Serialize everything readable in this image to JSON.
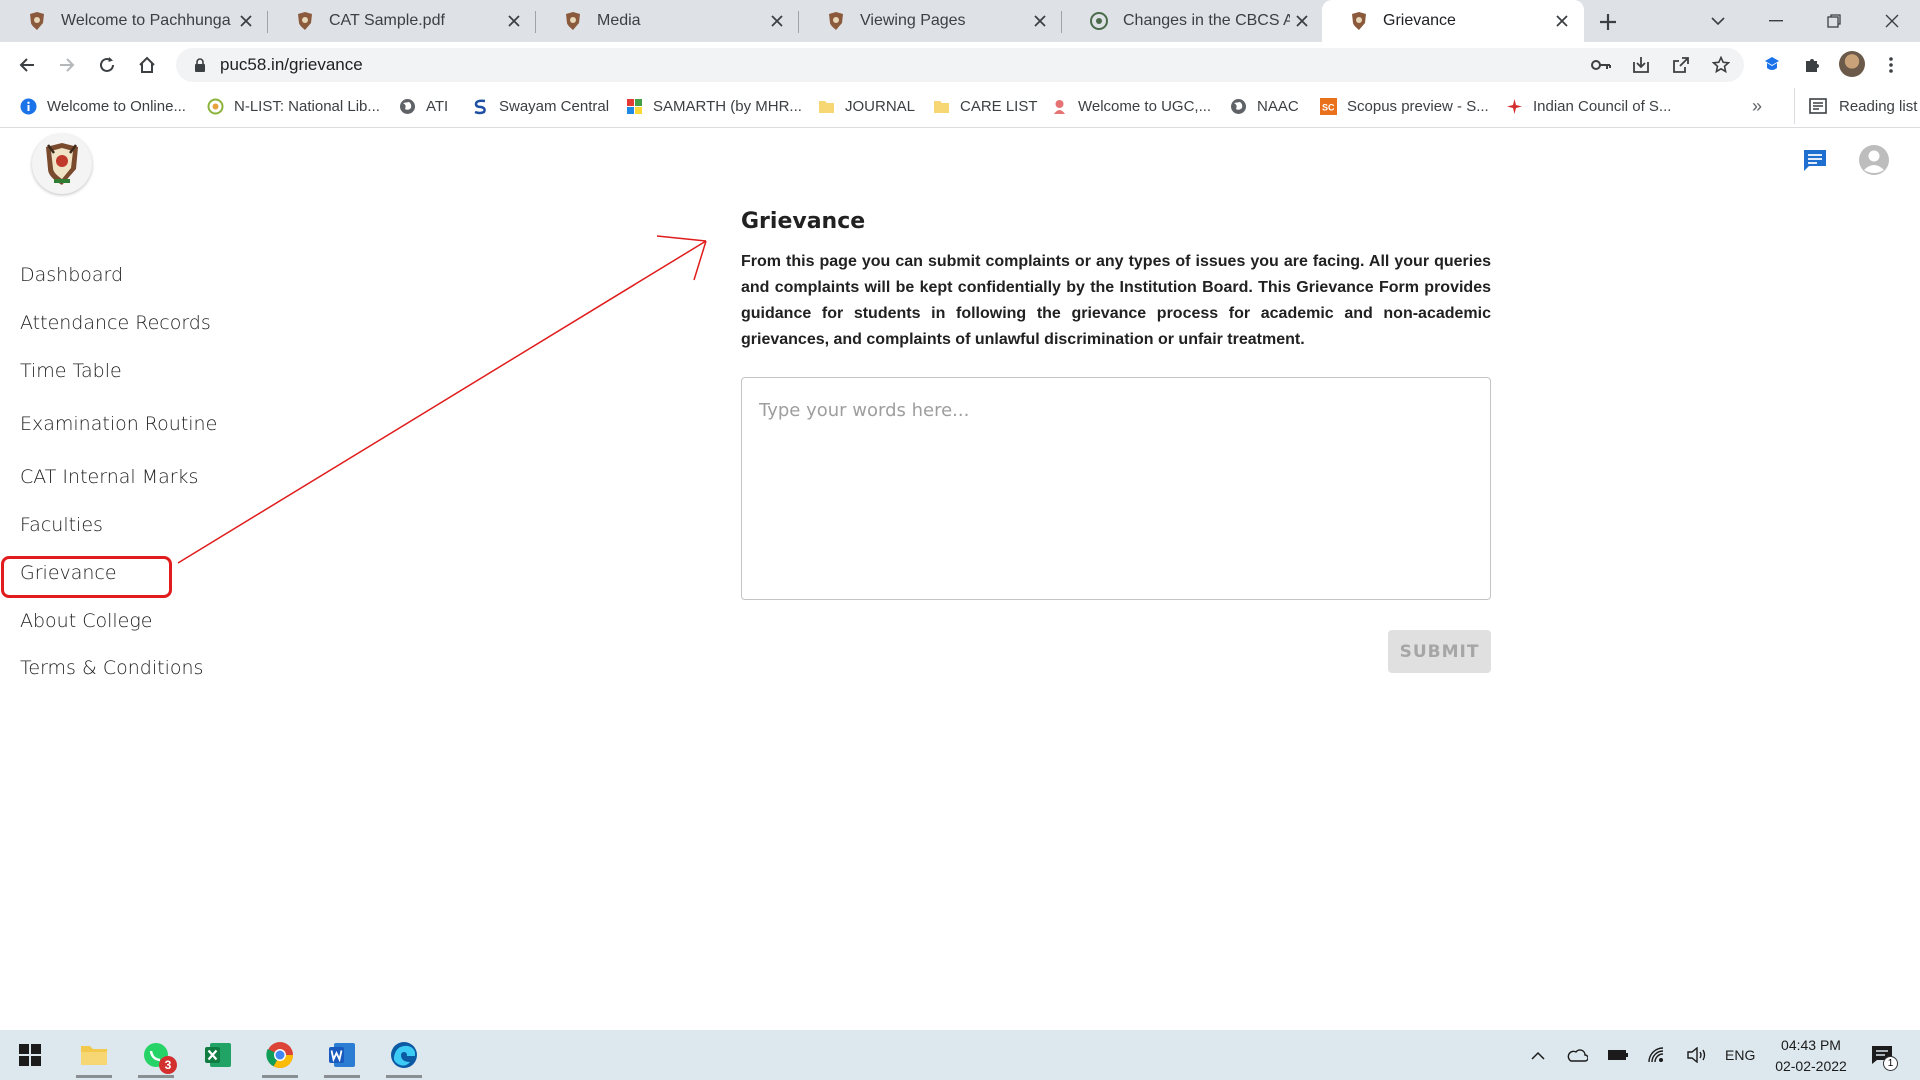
{
  "browser": {
    "tabs": [
      {
        "title": "Welcome to Pachhunga Uni",
        "icon": "college-crest-icon",
        "active": false
      },
      {
        "title": "CAT Sample.pdf",
        "icon": "college-crest-icon",
        "active": false
      },
      {
        "title": "Media",
        "icon": "college-crest-icon",
        "active": false
      },
      {
        "title": "Viewing Pages",
        "icon": "college-crest-icon",
        "active": false
      },
      {
        "title": "Changes in the CBCS Amen",
        "icon": "ugc-icon",
        "active": false
      },
      {
        "title": "Grievance",
        "icon": "college-crest-icon",
        "active": true
      }
    ],
    "url": "puc58.in/grievance",
    "bookmarks": [
      {
        "label": "Welcome to Online...",
        "icon": "info-blue-icon"
      },
      {
        "label": "N-LIST: National Lib...",
        "icon": "nlist-icon"
      },
      {
        "label": "ATI",
        "icon": "globe-icon"
      },
      {
        "label": "Swayam Central",
        "icon": "swayam-icon"
      },
      {
        "label": "SAMARTH (by MHR...",
        "icon": "samarth-icon"
      },
      {
        "label": "JOURNAL",
        "icon": "folder-icon"
      },
      {
        "label": "CARE LIST",
        "icon": "folder-icon"
      },
      {
        "label": "Welcome to UGC,...",
        "icon": "ugc-icon"
      },
      {
        "label": "NAAC",
        "icon": "globe-icon"
      },
      {
        "label": "Scopus preview - S...",
        "icon": "scopus-icon"
      },
      {
        "label": "Indian Council of S...",
        "icon": "icssr-icon"
      }
    ],
    "more_bookmarks": "»",
    "reading_list": "Reading list"
  },
  "sidebar": {
    "items": [
      {
        "label": "Dashboard"
      },
      {
        "label": "Attendance Records"
      },
      {
        "label": "Time Table"
      },
      {
        "label": "Examination Routine"
      },
      {
        "label": "CAT Internal Marks"
      },
      {
        "label": "Faculties"
      },
      {
        "label": "Grievance"
      },
      {
        "label": "About College"
      },
      {
        "label": "Terms & Conditions"
      }
    ],
    "highlighted": "Grievance"
  },
  "main": {
    "title": "Grievance",
    "description": "From this page you can submit complaints or any types of issues you are facing. All your queries and complaints will be kept confidentially by the Institution Board. This Grievance Form provides guidance for students in following the grievance process for academic and non-academic grievances, and complaints of unlawful discrimination or unfair treatment.",
    "textarea_placeholder": "Type your words here...",
    "textarea_value": "",
    "submit_label": "SUBMIT"
  },
  "taskbar": {
    "apps": [
      "start-icon",
      "file-explorer-icon",
      "whatsapp-icon",
      "excel-icon",
      "chrome-icon",
      "word-icon",
      "edge-icon"
    ],
    "whatsapp_badge": "3",
    "language": "ENG",
    "time": "04:43 PM",
    "date": "02-02-2022",
    "notification_count": "1"
  },
  "colors": {
    "annotation_red": "#e01c1c",
    "accent_blue": "#1a73e8",
    "tab_strip": "#dee1e6",
    "taskbar": "#dde8ee"
  }
}
